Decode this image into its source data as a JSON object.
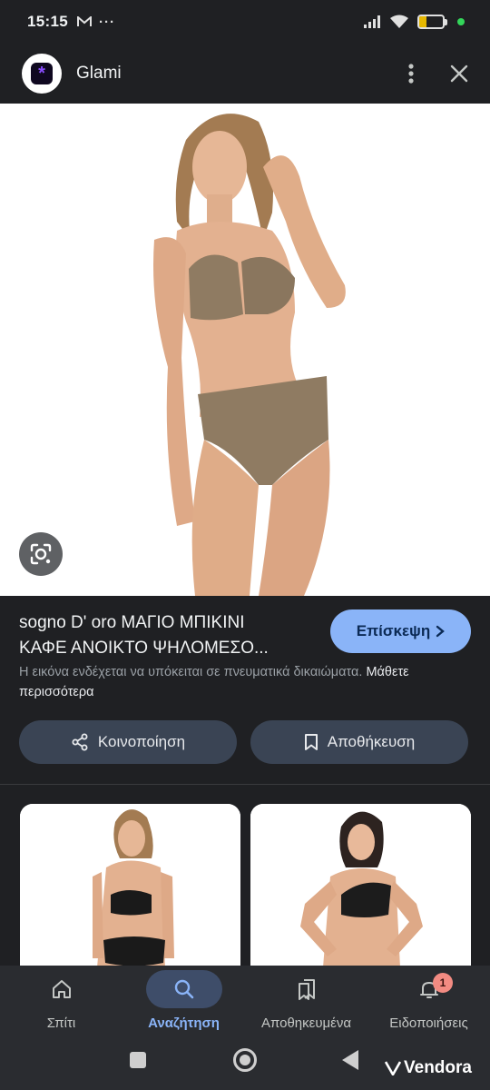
{
  "status_bar": {
    "time": "15:15",
    "battery": "32"
  },
  "app_header": {
    "title": "Glami"
  },
  "product": {
    "title_line1": "sogno D' oro ΜΑΓΙΟ ΜΠΙΚΙΝΙ",
    "title_line2": "ΚΑΦΕ ΑΝΟΙΚΤΟ ΨΗΛΟΜΕΣΟ...",
    "visit_label": "Επίσκεψη",
    "copyright_notice": "Η εικόνα ενδέχεται να υπόκειται σε πνευματικά δικαιώματα.",
    "learn_more": "Μάθετε περισσότερα"
  },
  "actions": {
    "share_label": "Κοινοποίηση",
    "save_label": "Αποθήκευση"
  },
  "bottom_nav": {
    "items": [
      {
        "label": "Σπίτι",
        "icon": "home-icon"
      },
      {
        "label": "Αναζήτηση",
        "icon": "search-icon"
      },
      {
        "label": "Αποθηκευμένα",
        "icon": "bookmarks-icon"
      },
      {
        "label": "Ειδοποιήσεις",
        "icon": "bell-icon"
      }
    ],
    "notification_count": "1"
  },
  "watermark": {
    "text": "Vendora"
  },
  "colors": {
    "accent": "#8ab4f8",
    "background": "#1f2023",
    "button": "#3a4454",
    "nav": "#2a2c30"
  }
}
